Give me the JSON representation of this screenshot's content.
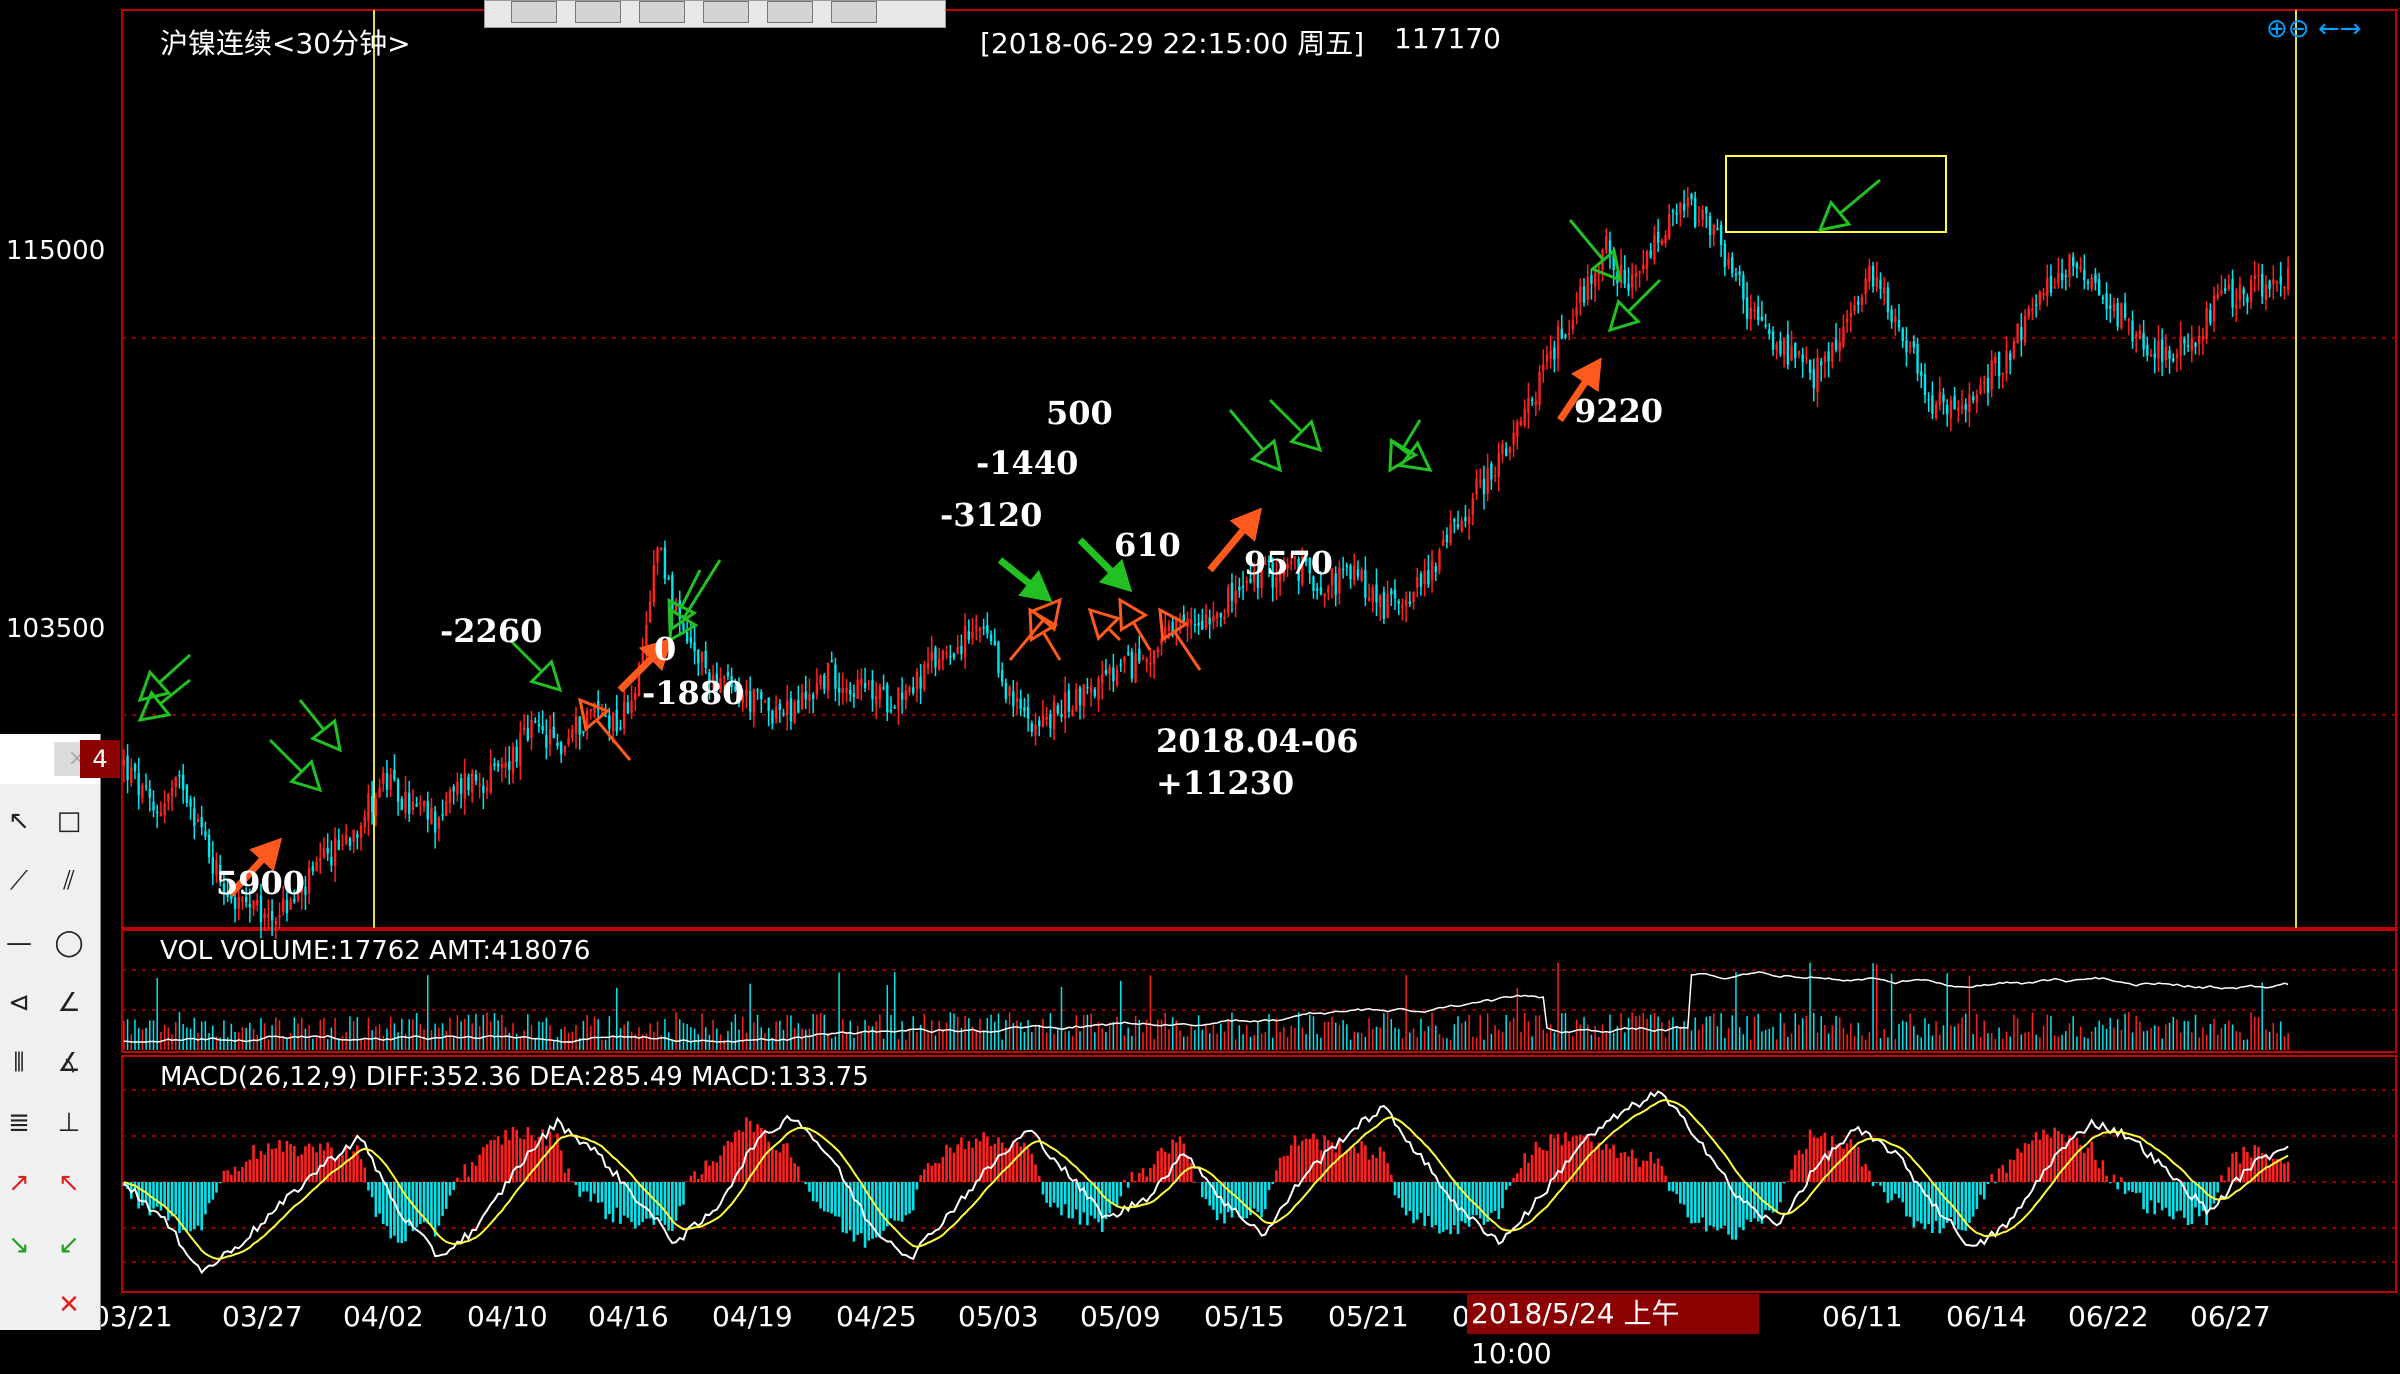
{
  "header": {
    "symbol": "沪镍连续<30分钟>",
    "datetime": "[2018-06-29  22:15:00 周五]",
    "price": "117170"
  },
  "price_axis": {
    "levels": [
      "115000",
      "103500"
    ]
  },
  "volume_panel": {
    "title": "VOL  VOLUME:17762 AMT:418076"
  },
  "macd_panel": {
    "title": "MACD(26,12,9)  DIFF:352.36 DEA:285.49 MACD:133.75"
  },
  "x_axis": {
    "dates": [
      "03/21",
      "03/27",
      "04/02",
      "04/10",
      "04/16",
      "04/19",
      "04/25",
      "05/03",
      "05/09",
      "05/15",
      "05/21",
      "0",
      "06/11",
      "06/14",
      "06/22",
      "06/27"
    ]
  },
  "crosshair_date": "2018/5/24 上午10:00",
  "annotations": [
    "5900",
    "-2260",
    "0",
    "-1880",
    "-3120",
    "-1440",
    "500",
    "610",
    "9570",
    "9220",
    "2018.04-06",
    "+11230"
  ],
  "side_badge": "4",
  "toolbox": {
    "close_label": "×"
  },
  "colors": {
    "up": "#ff2020",
    "down": "#00e5ee",
    "ma": "#ffff40",
    "grid": "#8b0000",
    "frame": "#c00000",
    "vline": "#e0e040",
    "arrow_buy": "#ff5a1e",
    "arrow_sell": "#22c022"
  },
  "chart_data": {
    "type": "candlestick",
    "title": "沪镍连续<30分钟>",
    "ylim": [
      97000,
      125000
    ],
    "y_ticks": [
      103500,
      115000
    ],
    "x_tick_labels": [
      "03/21",
      "03/27",
      "04/02",
      "04/10",
      "04/16",
      "04/19",
      "04/25",
      "05/03",
      "05/09",
      "05/15",
      "05/21",
      "06/11",
      "06/14",
      "06/22",
      "06/27"
    ],
    "price_path": [
      [
        0,
        102000
      ],
      [
        8,
        100500
      ],
      [
        16,
        101500
      ],
      [
        24,
        99000
      ],
      [
        30,
        97800
      ],
      [
        38,
        97300
      ],
      [
        46,
        97800
      ],
      [
        54,
        99000
      ],
      [
        62,
        100000
      ],
      [
        70,
        101500
      ],
      [
        76,
        100800
      ],
      [
        84,
        100300
      ],
      [
        92,
        101500
      ],
      [
        100,
        101600
      ],
      [
        110,
        103000
      ],
      [
        118,
        102500
      ],
      [
        126,
        103700
      ],
      [
        134,
        103300
      ],
      [
        140,
        105000
      ],
      [
        144,
        109000
      ],
      [
        150,
        106000
      ],
      [
        156,
        105000
      ],
      [
        164,
        104200
      ],
      [
        172,
        103800
      ],
      [
        180,
        103500
      ],
      [
        190,
        104800
      ],
      [
        198,
        104300
      ],
      [
        206,
        104000
      ],
      [
        214,
        104500
      ],
      [
        222,
        105500
      ],
      [
        232,
        106000
      ],
      [
        240,
        103800
      ],
      [
        248,
        103200
      ],
      [
        256,
        104000
      ],
      [
        264,
        104500
      ],
      [
        272,
        105000
      ],
      [
        280,
        105700
      ],
      [
        288,
        106300
      ],
      [
        298,
        107000
      ],
      [
        306,
        107700
      ],
      [
        316,
        108000
      ],
      [
        324,
        107500
      ],
      [
        332,
        107800
      ],
      [
        340,
        106800
      ],
      [
        350,
        107500
      ],
      [
        358,
        109000
      ],
      [
        366,
        110500
      ],
      [
        376,
        112000
      ],
      [
        384,
        114300
      ],
      [
        392,
        116000
      ],
      [
        400,
        117800
      ],
      [
        406,
        116300
      ],
      [
        414,
        118000
      ],
      [
        422,
        119000
      ],
      [
        430,
        118000
      ],
      [
        440,
        115500
      ],
      [
        448,
        114600
      ],
      [
        456,
        113800
      ],
      [
        464,
        115200
      ],
      [
        472,
        117000
      ],
      [
        480,
        115200
      ],
      [
        488,
        113000
      ],
      [
        496,
        112700
      ],
      [
        506,
        114200
      ],
      [
        516,
        116000
      ],
      [
        526,
        117500
      ],
      [
        536,
        116000
      ],
      [
        546,
        114800
      ],
      [
        556,
        114600
      ],
      [
        566,
        116200
      ],
      [
        576,
        116500
      ],
      [
        584,
        117000
      ]
    ],
    "macd_diff": [
      0,
      -5,
      -12,
      -8,
      -3,
      2,
      6,
      -4,
      -10,
      -6,
      2,
      8,
      4,
      -2,
      -8,
      -4,
      5,
      9,
      3,
      -6,
      -10,
      -4,
      2,
      7,
      1,
      -5,
      -2,
      4,
      -3,
      -7,
      1,
      6,
      10,
      3,
      -4,
      -8,
      -2,
      5,
      9,
      12,
      6,
      -2,
      -6,
      2,
      7,
      4,
      -3,
      -9,
      -5,
      3,
      8,
      6,
      1,
      -4,
      2,
      5
    ]
  }
}
